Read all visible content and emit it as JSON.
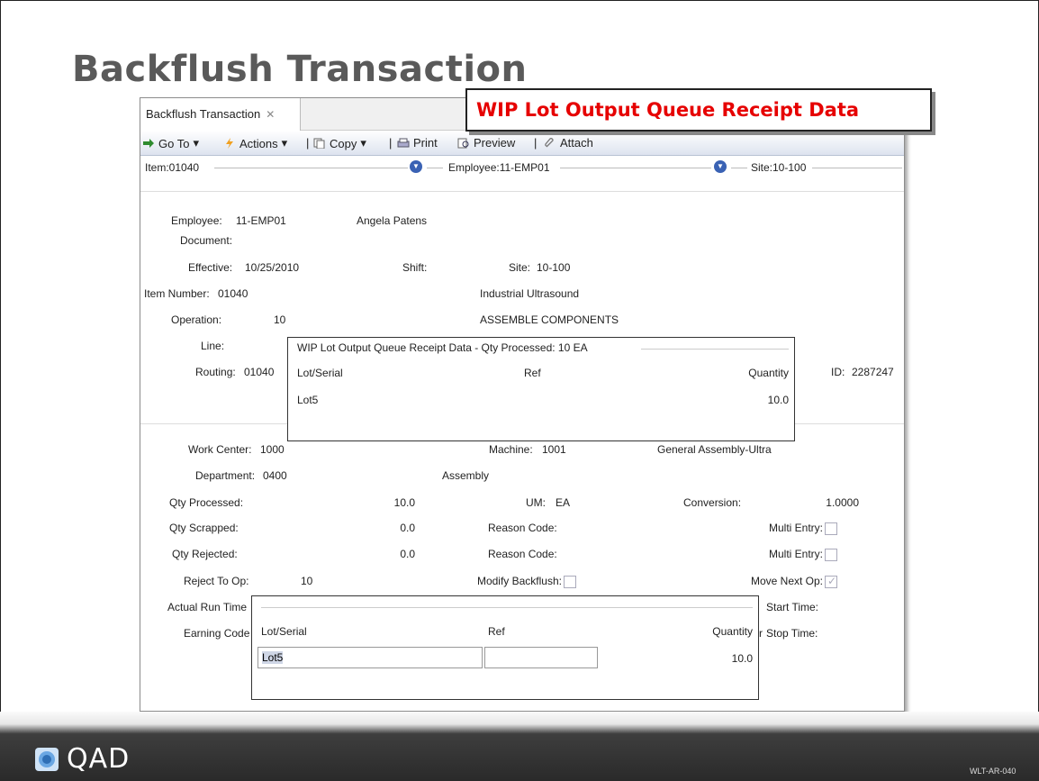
{
  "slide": {
    "title": "Backflush Transaction",
    "slide_code": "WLT-AR-040",
    "logo_text": "QAD"
  },
  "callout": "WIP Lot Output Queue Receipt Data",
  "window": {
    "tab_label": "Backflush Transaction",
    "tab_close": "✕",
    "toolbar": {
      "goto": "Go To",
      "actions": "Actions",
      "copy": "Copy",
      "print": "Print",
      "preview": "Preview",
      "attach": "Attach"
    },
    "breadcrumb": {
      "item": "Item:01040",
      "employee": "Employee:11-EMP01",
      "site": "Site:10-100"
    }
  },
  "header_fields": {
    "employee_label": "Employee:",
    "employee_value": "11-EMP01",
    "employee_name": "Angela Patens",
    "document_label": "Document:",
    "effective_label": "Effective:",
    "effective_value": "10/25/2010",
    "shift_label": "Shift:",
    "site_label": "Site:",
    "site_value": "10-100",
    "item_label": "Item Number:",
    "item_value": "01040",
    "item_desc": "Industrial Ultrasound",
    "operation_label": "Operation:",
    "operation_value": "10",
    "operation_desc": "ASSEMBLE COMPONENTS",
    "line_label": "Line:",
    "routing_label": "Routing:",
    "routing_value": "01040",
    "id_label": "ID:",
    "id_value": "2287247"
  },
  "popup_top": {
    "title": "WIP Lot Output Queue Receipt Data - Qty Processed: 10 EA",
    "columns": {
      "lot": "Lot/Serial",
      "ref": "Ref",
      "qty": "Quantity"
    },
    "row": {
      "lot": "Lot5",
      "ref": "",
      "qty": "10.0"
    }
  },
  "detail_fields": {
    "work_center_label": "Work Center:",
    "work_center_value": "1000",
    "machine_label": "Machine:",
    "machine_value": "1001",
    "machine_desc": "General Assembly-Ultra",
    "department_label": "Department:",
    "department_value": "0400",
    "department_desc": "Assembly",
    "qty_processed_label": "Qty Processed:",
    "qty_processed_value": "10.0",
    "um_label": "UM:",
    "um_value": "EA",
    "conversion_label": "Conversion:",
    "conversion_value": "1.0000",
    "qty_scrapped_label": "Qty Scrapped:",
    "qty_scrapped_value": "0.0",
    "reason_code_label": "Reason Code:",
    "multi_entry_label": "Multi Entry:",
    "qty_rejected_label": "Qty Rejected:",
    "qty_rejected_value": "0.0",
    "reject_to_op_label": "Reject To Op:",
    "reject_to_op_value": "10",
    "modify_backflush_label": "Modify Backflush:",
    "move_next_op_label": "Move Next Op:",
    "actual_run_time_label": "Actual Run Time",
    "start_time_label": "Start Time:",
    "earning_code_label": "Earning Code",
    "stop_time_label": "Stop Time:",
    "stop_time_prefix": "r"
  },
  "popup_bottom": {
    "columns": {
      "lot": "Lot/Serial",
      "ref": "Ref",
      "qty": "Quantity"
    },
    "row": {
      "lot": "Lot5",
      "ref": "",
      "qty": "10.0"
    }
  }
}
